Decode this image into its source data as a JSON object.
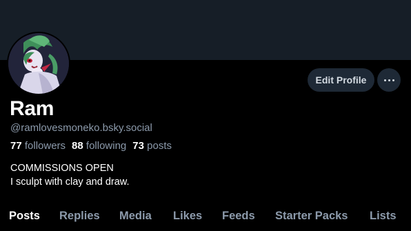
{
  "profile": {
    "name": "Ram",
    "handle": "@ramlovesmoneko.bsky.social",
    "followers_count": "77",
    "followers_label": "followers",
    "following_count": "88",
    "following_label": "following",
    "posts_count": "73",
    "posts_label": "posts",
    "bio_line1": "COMMISSIONS OPEN",
    "bio_line2": "I sculpt with clay and draw."
  },
  "actions": {
    "edit_profile_label": "Edit Profile",
    "more_icon": "ellipsis-icon"
  },
  "tabs": [
    {
      "label": "Posts",
      "active": true
    },
    {
      "label": "Replies"
    },
    {
      "label": "Media"
    },
    {
      "label": "Likes"
    },
    {
      "label": "Feeds"
    },
    {
      "label": "Starter Packs"
    },
    {
      "label": "Lists"
    }
  ],
  "colors": {
    "background": "#000000",
    "banner": "#161e27",
    "button_bg": "#1e2936",
    "muted_text": "#8c9aab",
    "primary_text": "#ffffff"
  }
}
